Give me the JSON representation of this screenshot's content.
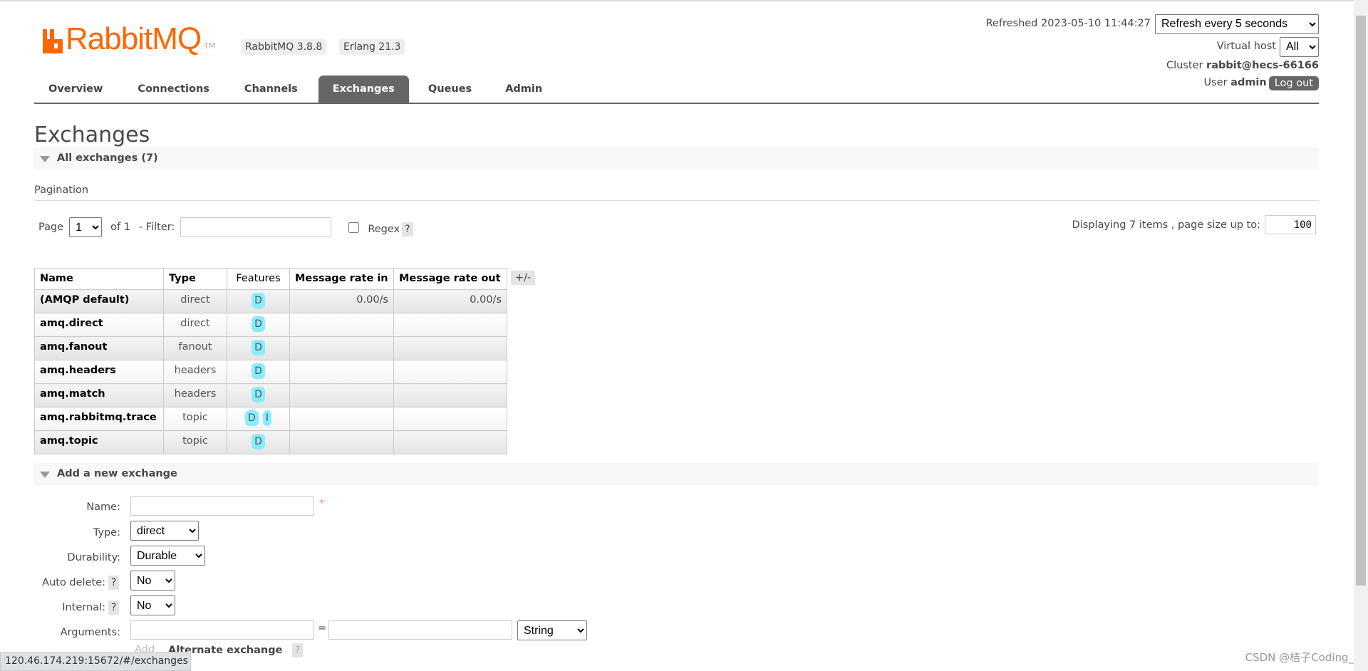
{
  "header": {
    "logo_text": "RabbitMQ",
    "logo_tm": "TM",
    "version_badge": "RabbitMQ 3.8.8",
    "erlang_badge": "Erlang 21.3",
    "refreshed": "Refreshed 2023-05-10 11:44:27",
    "refresh_select": "Refresh every 5 seconds",
    "vhost_label": "Virtual host",
    "vhost_select": "All",
    "cluster_label": "Cluster",
    "cluster_value": "rabbit@hecs-66166",
    "user_label": "User",
    "user_value": "admin",
    "logout": "Log out",
    "brand_color": "#ff6600"
  },
  "nav": {
    "tabs": [
      {
        "label": "Overview",
        "active": false
      },
      {
        "label": "Connections",
        "active": false
      },
      {
        "label": "Channels",
        "active": false
      },
      {
        "label": "Exchanges",
        "active": true
      },
      {
        "label": "Queues",
        "active": false
      },
      {
        "label": "Admin",
        "active": false
      }
    ]
  },
  "page": {
    "title": "Exchanges",
    "all_section": "All exchanges (7)"
  },
  "pagination": {
    "label": "Pagination",
    "page_label": "Page",
    "page_value": "1",
    "of_label": "of 1",
    "filter_label": "- Filter:",
    "filter_value": "",
    "regex_label": "Regex",
    "help": "?",
    "displaying": "Displaying 7 items , page size up to:",
    "page_size": "100"
  },
  "table": {
    "headers": [
      "Name",
      "Type",
      "Features",
      "Message rate in",
      "Message rate out"
    ],
    "toggle": "+/-",
    "rows": [
      {
        "name": "(AMQP default)",
        "type": "direct",
        "features": [
          "D"
        ],
        "rate_in": "0.00/s",
        "rate_out": "0.00/s"
      },
      {
        "name": "amq.direct",
        "type": "direct",
        "features": [
          "D"
        ],
        "rate_in": "",
        "rate_out": ""
      },
      {
        "name": "amq.fanout",
        "type": "fanout",
        "features": [
          "D"
        ],
        "rate_in": "",
        "rate_out": ""
      },
      {
        "name": "amq.headers",
        "type": "headers",
        "features": [
          "D"
        ],
        "rate_in": "",
        "rate_out": ""
      },
      {
        "name": "amq.match",
        "type": "headers",
        "features": [
          "D"
        ],
        "rate_in": "",
        "rate_out": ""
      },
      {
        "name": "amq.rabbitmq.trace",
        "type": "topic",
        "features": [
          "D",
          "I"
        ],
        "rate_in": "",
        "rate_out": ""
      },
      {
        "name": "amq.topic",
        "type": "topic",
        "features": [
          "D"
        ],
        "rate_in": "",
        "rate_out": ""
      }
    ]
  },
  "add": {
    "section": "Add a new exchange",
    "name_label": "Name:",
    "name_value": "",
    "required": "*",
    "type_label": "Type:",
    "type_value": "direct",
    "durability_label": "Durability:",
    "durability_value": "Durable",
    "autodelete_label": "Auto delete:",
    "autodelete_value": "No",
    "internal_label": "Internal:",
    "internal_value": "No",
    "arguments_label": "Arguments:",
    "arg_eq": "=",
    "arg_type": "String",
    "add_label": "Add",
    "alternate": "Alternate exchange",
    "help": "?"
  },
  "statusbar": "120.46.174.219:15672/#/exchanges",
  "watermark": "CSDN @桔子Coding_"
}
